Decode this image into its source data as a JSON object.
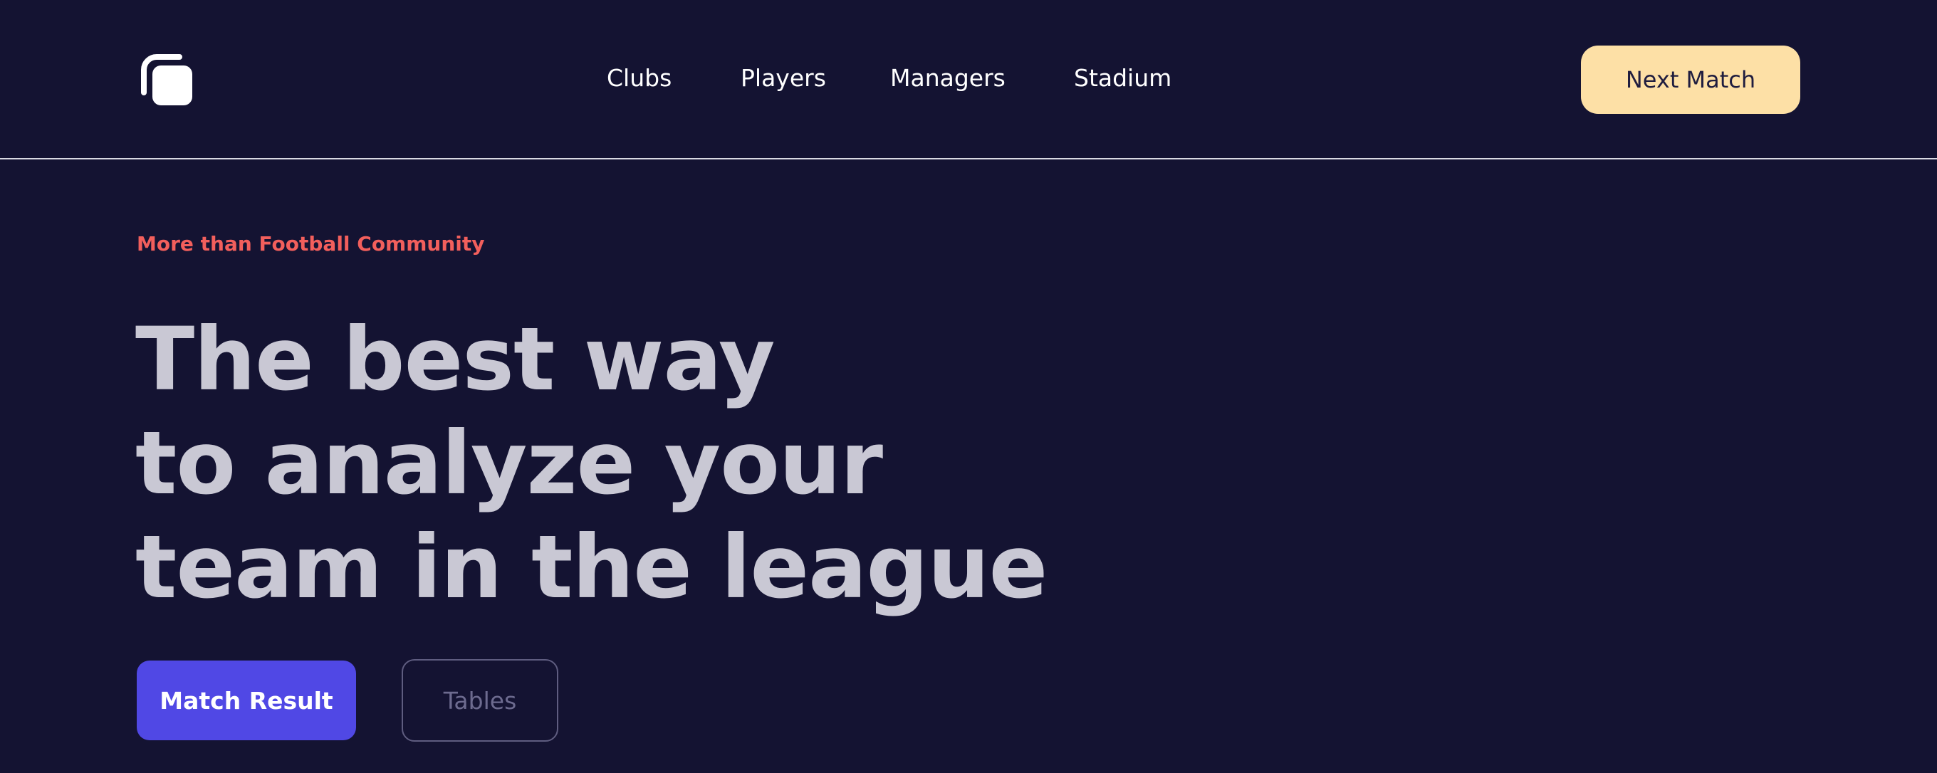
{
  "header": {
    "logo_icon": "rounded-squares-logo-icon",
    "nav": {
      "clubs": "Clubs",
      "players": "Players",
      "managers": "Managers",
      "stadium": "Stadium"
    },
    "cta_label": "Next Match"
  },
  "hero": {
    "eyebrow": "More than Football Community",
    "title_lines": [
      "The best way",
      "to analyze your",
      "team in the league"
    ],
    "primary_button": "Match Result",
    "secondary_button": "Tables"
  },
  "colors": {
    "background": "#141332",
    "eyebrow": "#f25f5c",
    "title": "#c9c8d4",
    "cta_bg": "#fde0a6",
    "primary_bg": "#5048e5",
    "secondary_border": "#5f5d80"
  }
}
